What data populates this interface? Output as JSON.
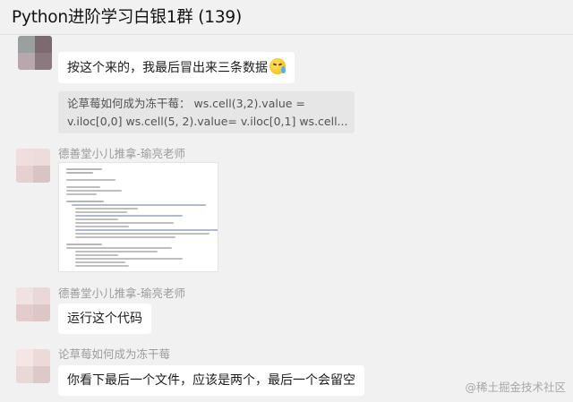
{
  "window": {
    "title": "Python进阶学习白银1群 (139)"
  },
  "messages": [
    {
      "sender": "",
      "text": "按这个来的，我最后冒出来三条数据",
      "emoji": "sweat-smile-emoji"
    },
    {
      "quote_line1": "论草莓如何成为冻干莓：    ws.cell(3,2).value =",
      "quote_line2": "v.iloc[0,0]     ws.cell(5, 2).value= v.iloc[0,1]     ws.cell..."
    },
    {
      "sender": "德善堂小儿推拿-瑜亮老师",
      "attachment": "code-screenshot-image"
    },
    {
      "sender": "德善堂小儿推拿-瑜亮老师",
      "text": "运行这个代码"
    },
    {
      "sender": "论草莓如何成为冻干莓",
      "text": "你看下最后一个文件，应该是两个，最后一个会留空"
    }
  ],
  "watermark": "@稀土掘金技术社区",
  "colors": {
    "background": "#f1f1f1",
    "bubble": "#ffffff",
    "quote": "#e6e6e6",
    "sender": "#9c9c9c"
  }
}
